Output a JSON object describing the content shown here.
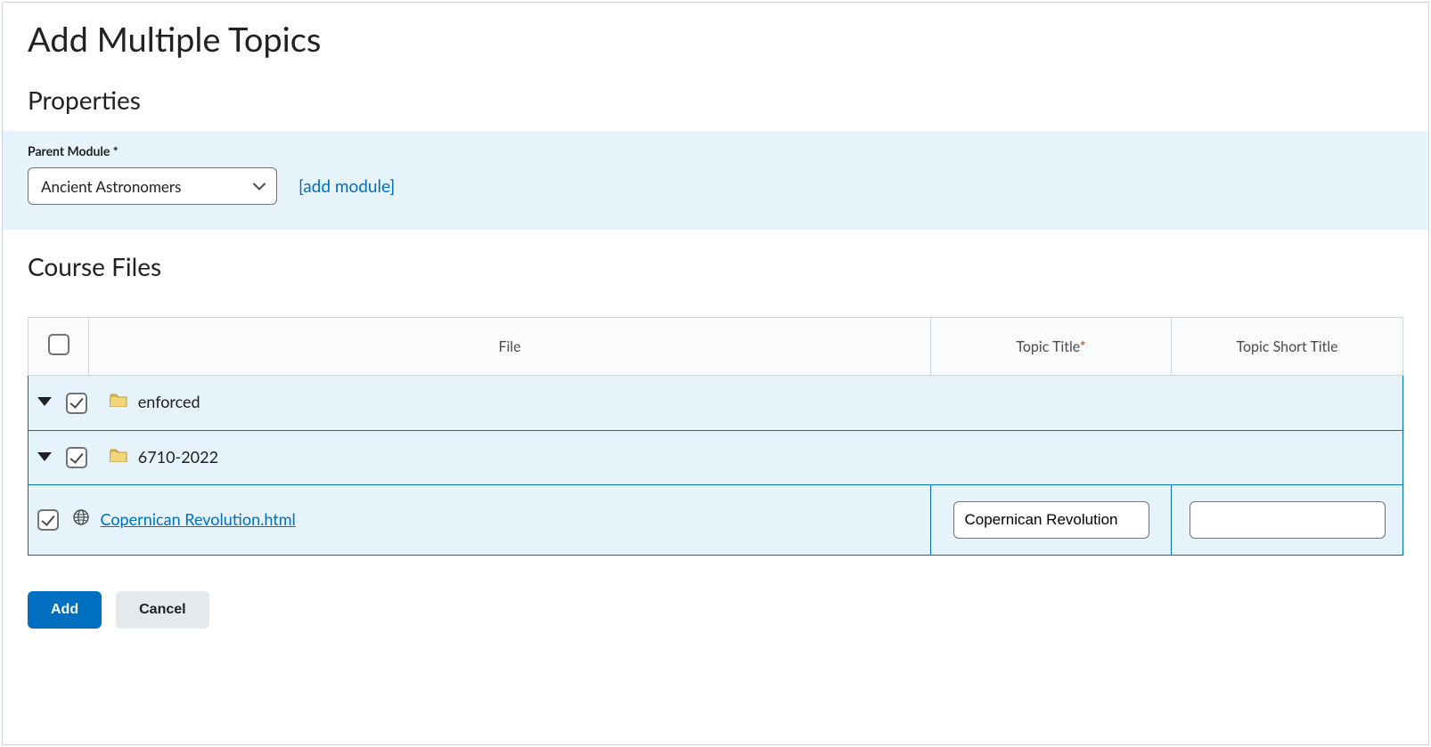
{
  "page_title": "Add Multiple Topics",
  "properties": {
    "section_title": "Properties",
    "parent_module_label": "Parent Module *",
    "parent_module_value": "Ancient Astronomers",
    "add_module_link": "[add module]"
  },
  "course_files": {
    "section_title": "Course Files",
    "headers": {
      "file": "File",
      "topic_title": "Topic Title",
      "topic_title_required": "*",
      "topic_short_title": "Topic Short Title"
    },
    "rows": {
      "enforced_label": "enforced",
      "course_folder_label": "6710-2022",
      "file_name": "Copernican Revolution.html",
      "topic_title_value": "Copernican Revolution",
      "topic_short_title_value": ""
    }
  },
  "buttons": {
    "add": "Add",
    "cancel": "Cancel"
  }
}
